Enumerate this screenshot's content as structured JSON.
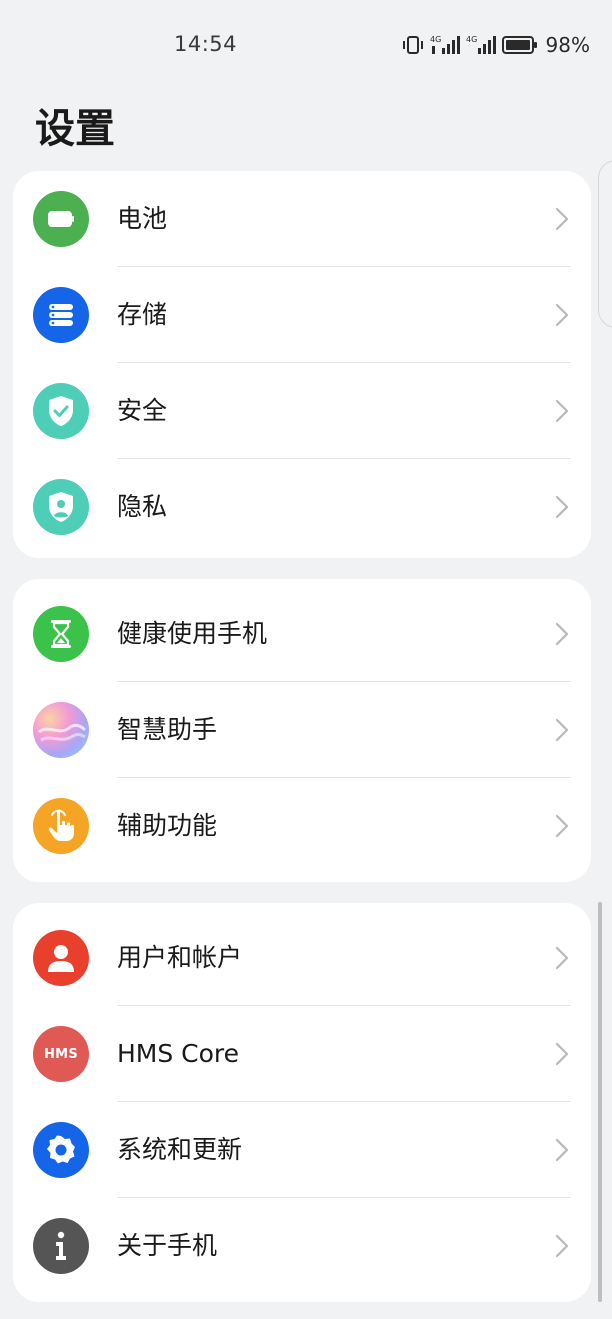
{
  "status": {
    "time": "14:54",
    "battery_percent": "98%"
  },
  "page": {
    "title": "设置"
  },
  "groups": [
    {
      "items": [
        {
          "label": "电池",
          "icon": "battery-icon",
          "color": "#4caf50"
        },
        {
          "label": "存储",
          "icon": "storage-icon",
          "color": "#1565e8"
        },
        {
          "label": "安全",
          "icon": "security-shield-icon",
          "color": "#4ecdb7"
        },
        {
          "label": "隐私",
          "icon": "privacy-shield-icon",
          "color": "#4ecdb7"
        }
      ]
    },
    {
      "items": [
        {
          "label": "健康使用手机",
          "icon": "hourglass-icon",
          "color": "#3bc24a"
        },
        {
          "label": "智慧助手",
          "icon": "smart-assistant-icon",
          "color": "#e89ad4"
        },
        {
          "label": "辅助功能",
          "icon": "accessibility-hand-icon",
          "color": "#f5a425"
        }
      ]
    },
    {
      "items": [
        {
          "label": "用户和帐户",
          "icon": "user-icon",
          "color": "#e8402d"
        },
        {
          "label": "HMS Core",
          "icon": "hms-icon",
          "color": "#e05a55",
          "icon_text": "HMS"
        },
        {
          "label": "系统和更新",
          "icon": "gear-icon",
          "color": "#1565e8"
        },
        {
          "label": "关于手机",
          "icon": "info-icon",
          "color": "#555555"
        }
      ]
    }
  ]
}
